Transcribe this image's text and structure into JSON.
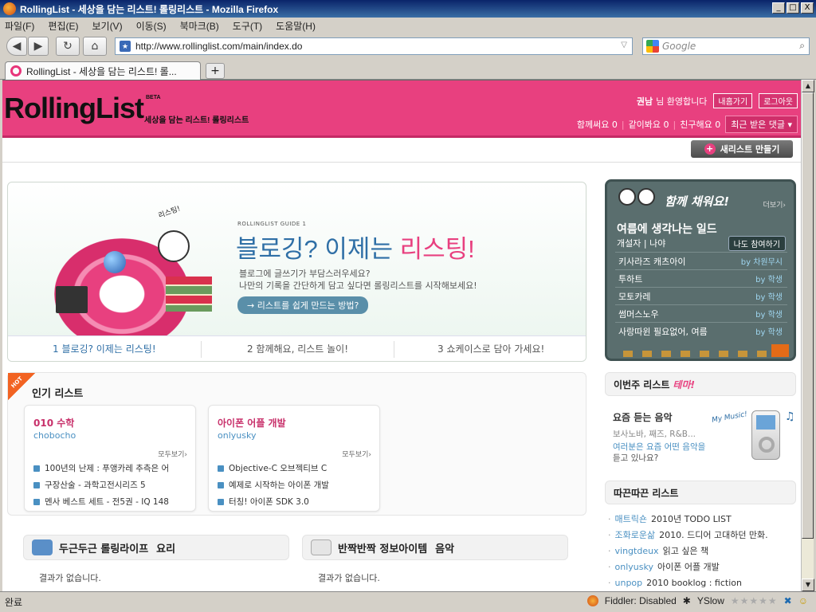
{
  "window": {
    "title": "RollingList - 세상을 담는 리스트! 롤링리스트 - Mozilla Firefox",
    "controls": [
      "_",
      "□",
      "X"
    ]
  },
  "menu": [
    "파일(F)",
    "편집(E)",
    "보기(V)",
    "이동(S)",
    "북마크(B)",
    "도구(T)",
    "도움말(H)"
  ],
  "nav": {
    "url": "http://www.rollinglist.com/main/index.do",
    "search_placeholder": "Google"
  },
  "tab": {
    "label": "RollingList - 세상을 담는 리스트! 롤..."
  },
  "header": {
    "logo": "RollingList",
    "beta": "BETA",
    "tagline": "세상을 담는 리스트! 롤링리스트",
    "user": "권남",
    "welcome": "님 환영합니다",
    "mypage": "내홈가기",
    "logout": "로그아웃",
    "stats": [
      "함께써요 0",
      "같이봐요 0",
      "친구해요 0"
    ],
    "recent": "최근 받은 댓글"
  },
  "new_list_button": "새리스트 만들기",
  "banner": {
    "guide": "ROLLINGLIST GUIDE 1",
    "title_a": "블로깅? 이제는 ",
    "title_b": "리스팅!",
    "desc1": "블로그에 글쓰기가 부담스러우세요?",
    "desc2": "나만의 기록을 간단하게 담고 싶다면 롤링리스트를 시작해보세요!",
    "how": "→ 리스트를 쉽게 만드는 방법?",
    "bubble": "리스팅!",
    "tabs": [
      "1 블로깅? 이제는 리스팅!",
      "2 함께해요, 리스트 놀이!",
      "3 쇼케이스로 담아 가세요!"
    ]
  },
  "popular": {
    "badge": "HOT",
    "title": "인기 리스트",
    "cards": [
      {
        "title": "010 수학",
        "user": "chobocho",
        "more": "모두보기›",
        "items": [
          "100년의 난제 : 푸앵카레 추측은 어",
          "구장산술 - 과학고전시리즈 5",
          "멘사 베스트 세트 - 전5권 - IQ 148"
        ]
      },
      {
        "title": "아이폰 어플 개발",
        "user": "onlyusky",
        "more": "모두보기›",
        "items": [
          "Objective-C 오브젝티브 C",
          "예제로 시작하는 아이폰 개발",
          "터칭! 아이폰 SDK 3.0"
        ]
      }
    ]
  },
  "sections": [
    {
      "label": "두근두근 롤링라이프",
      "category": "요리",
      "empty": "결과가 없습니다."
    },
    {
      "label": "반짝반짝 정보아이템",
      "category": "음악",
      "empty": "결과가 없습니다."
    }
  ],
  "board": {
    "title": "함께 채워요!",
    "more": "더보기›",
    "topic": "여름에 생각나는 일드",
    "owner_label": "개설자",
    "owner": "나야",
    "join": "나도 참여하기",
    "items": [
      {
        "title": "키사라즈 캐츠아이",
        "by": "by 차원무시"
      },
      {
        "title": "투하트",
        "by": "by 학생"
      },
      {
        "title": "모토카레",
        "by": "by 학생"
      },
      {
        "title": "썸머스노우",
        "by": "by 학생"
      },
      {
        "title": "사랑따윈 필요없어, 여름",
        "by": "by 학생"
      }
    ]
  },
  "theme": {
    "label": "이번주 리스트",
    "accent": "테마!",
    "heading": "요즘 듣는 음악",
    "sub": "보사노바, 째즈, R&B...",
    "q1": "여러분은 요즘 어떤 음악을",
    "q2": "듣고 있나요?",
    "mymusic": "My Music!"
  },
  "fresh": {
    "title": "따끈따끈 리스트",
    "items": [
      {
        "user": "매트릭숀",
        "title": "2010년 TODO LIST"
      },
      {
        "user": "조화로운삶",
        "title": "2010. 드디어 고대하던 만화."
      },
      {
        "user": "vingtdeux",
        "title": "읽고 싶은 책"
      },
      {
        "user": "onlyusky",
        "title": "아이폰 어플 개발"
      },
      {
        "user": "unpop",
        "title": "2010 booklog : fiction"
      }
    ]
  },
  "status": {
    "text": "완료",
    "fiddler": "Fiddler: Disabled",
    "yslow": "YSlow"
  },
  "colors": {
    "brand": "#e8407f",
    "link": "#4a90c2",
    "board": "#5a6e6e"
  }
}
